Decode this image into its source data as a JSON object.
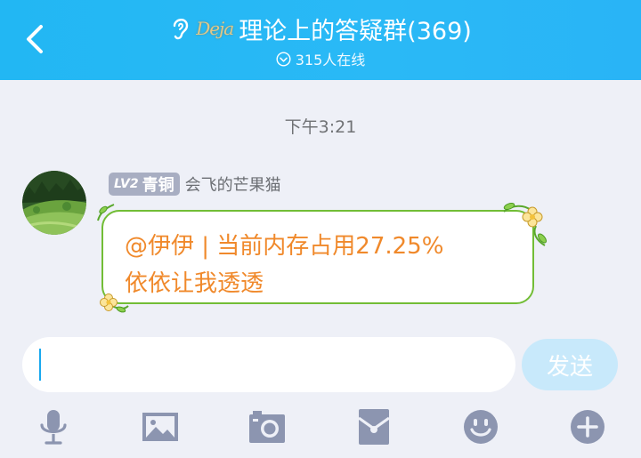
{
  "header": {
    "back_icon": "chevron-left-icon",
    "ear_icon": "ear-icon",
    "badge_text": "Deja",
    "title": "理论上的答疑群(369)",
    "online_text": "315人在线",
    "colors": {
      "bar": "#29b6f6",
      "text": "#ffffff"
    }
  },
  "chat": {
    "timestamp": "下午3:21",
    "message": {
      "level": "LV2",
      "rank": "青铜",
      "sender": "会飞的芒果猫",
      "lines": [
        "@伊伊 | 当前内存占用27.25%",
        "依依让我透透"
      ],
      "colors": {
        "text": "#f0892b",
        "border": "#72bd36",
        "badge": "#a8aec2"
      }
    }
  },
  "composer": {
    "input_value": "",
    "send_label": "发送"
  },
  "toolbar": {
    "icons": [
      "microphone-icon",
      "image-icon",
      "camera-icon",
      "red-packet-icon",
      "emoji-icon",
      "plus-icon"
    ]
  }
}
